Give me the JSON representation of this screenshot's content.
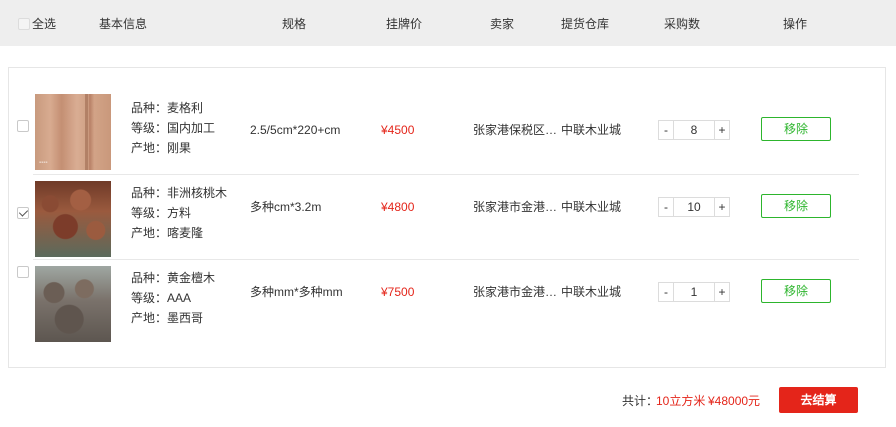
{
  "header": {
    "select_all": "全选",
    "columns": {
      "info": "基本信息",
      "spec": "规格",
      "price": "挂牌价",
      "seller": "卖家",
      "warehouse": "提货仓库",
      "qty": "采购数",
      "action": "操作"
    }
  },
  "items": [
    {
      "checked": false,
      "variety": "品种：麦格利",
      "grade": "等级：国内加工",
      "origin": "产地：刚果",
      "spec": "2.5/5cm*220+cm",
      "price": "¥4500",
      "seller": "张家港保税区…",
      "warehouse": "中联木业城",
      "qty": "8",
      "remove_label": "移除"
    },
    {
      "checked": true,
      "variety": "品种：非洲核桃木",
      "grade": "等级：方料",
      "origin": "产地：喀麦隆",
      "spec": "多种cm*3.2m",
      "price": "¥4800",
      "seller": "张家港市金港…",
      "warehouse": "中联木业城",
      "qty": "10",
      "remove_label": "移除"
    },
    {
      "checked": false,
      "variety": "品种：黄金檀木",
      "grade": "等级：AAA",
      "origin": "产地：墨西哥",
      "spec": "多种mm*多种mm",
      "price": "¥7500",
      "seller": "张家港市金港…",
      "warehouse": "中联木业城",
      "qty": "1",
      "remove_label": "移除"
    }
  ],
  "stepper": {
    "minus": "-",
    "plus": "+"
  },
  "footer": {
    "total_label": "共计：",
    "total_volume": "10立方米",
    "total_price": "¥48000元",
    "checkout_label": "去结算"
  },
  "colors": {
    "accent_red": "#e4251a",
    "accent_green": "#2db52d",
    "header_bg": "#eeeeee"
  }
}
